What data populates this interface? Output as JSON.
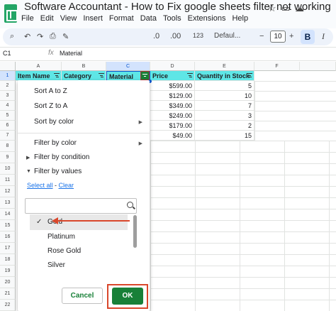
{
  "app": {
    "title": "Software Accountant - How to Fix google sheets filter not working",
    "menu": [
      "File",
      "Edit",
      "View",
      "Insert",
      "Format",
      "Data",
      "Tools",
      "Extensions",
      "Help"
    ],
    "title_icons": [
      "star-icon",
      "folder-move-icon",
      "cloud-status-icon"
    ]
  },
  "toolbar": {
    "number_format": "123",
    "font": "Defaul...",
    "font_size": "10",
    "bold": "B"
  },
  "formula_bar": {
    "cell_ref": "C1",
    "fx": "fx",
    "value": "Material"
  },
  "grid": {
    "columns": [
      "A",
      "B",
      "C",
      "D",
      "E",
      "F"
    ],
    "rows": [
      "1",
      "2",
      "3",
      "4",
      "5",
      "6",
      "7",
      "8",
      "9",
      "10",
      "11",
      "12",
      "13",
      "14",
      "15",
      "16",
      "17",
      "18",
      "19",
      "20",
      "21",
      "22"
    ],
    "headers": [
      "Item Name",
      "Category",
      "Material",
      "Price",
      "Quantity in Stock"
    ],
    "prices": [
      "$599.00",
      "$129.00",
      "$349.00",
      "$249.00",
      "$179.00",
      "$49.00"
    ],
    "quantities": [
      "5",
      "10",
      "7",
      "3",
      "2",
      "15"
    ],
    "colors": {
      "header_fill": "#5ee6e6",
      "filter_active": "#188038"
    }
  },
  "filter_menu": {
    "sort_az": "Sort A to Z",
    "sort_za": "Sort Z to A",
    "sort_color": "Sort by color",
    "filter_color": "Filter by color",
    "filter_condition": "Filter by condition",
    "filter_values": "Filter by values",
    "select_all": "Select all",
    "separator": " - ",
    "clear": "Clear",
    "search_placeholder": "",
    "options": [
      {
        "label": "Gold",
        "checked": true
      },
      {
        "label": "Platinum",
        "checked": false
      },
      {
        "label": "Rose Gold",
        "checked": false
      },
      {
        "label": "Silver",
        "checked": false
      }
    ],
    "cancel": "Cancel",
    "ok": "OK"
  }
}
